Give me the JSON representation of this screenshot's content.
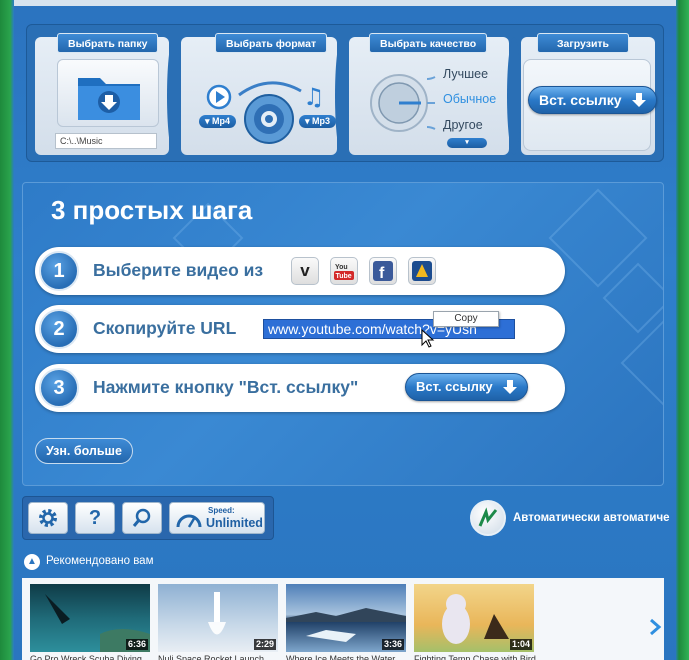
{
  "steps": {
    "folder": {
      "tab": "Выбрать папку",
      "path": "C:\\..\\Music"
    },
    "format": {
      "tab": "Выбрать формат",
      "video": "Mp4",
      "audio": "Mp3"
    },
    "quality": {
      "tab": "Выбрать качество",
      "options": [
        "Лучшее",
        "Обычное",
        "Другое"
      ]
    },
    "upload": {
      "tab": "Загрузить",
      "button": "Вст. ссылку"
    }
  },
  "main": {
    "title": "3 простых шага",
    "step1": {
      "num": "1",
      "text": "Выберите видео из"
    },
    "step2": {
      "num": "2",
      "text": "Скопируйте URL",
      "url": "www.youtube.com/watch?v=yUsh",
      "copy": "Copy"
    },
    "step3": {
      "num": "3",
      "text": "Нажмите кнопку \"Вст. ссылку\"",
      "button": "Вст. ссылку"
    },
    "more": "Узн. больше"
  },
  "toolbar": {
    "speed_label": "Speed:",
    "speed_value": "Unlimited"
  },
  "auto": {
    "text": "Автоматически автоматиче"
  },
  "recommended": {
    "label": "Рекомендовано вам",
    "videos": [
      {
        "duration": "6:36",
        "title": "Go Pro Wreck Scuba Diving"
      },
      {
        "duration": "2:29",
        "title": "Nuli Space Rocket Launch"
      },
      {
        "duration": "3:36",
        "title": "Where Ice Meets the Water"
      },
      {
        "duration": "1:04",
        "title": "Fighting Temp Chase with Bird"
      }
    ]
  },
  "colors": {
    "accent": "#2b7fc9",
    "panel": "#2a6fb5",
    "step_text": "#3a6f9f",
    "url_highlight": "#2d6fd6"
  }
}
